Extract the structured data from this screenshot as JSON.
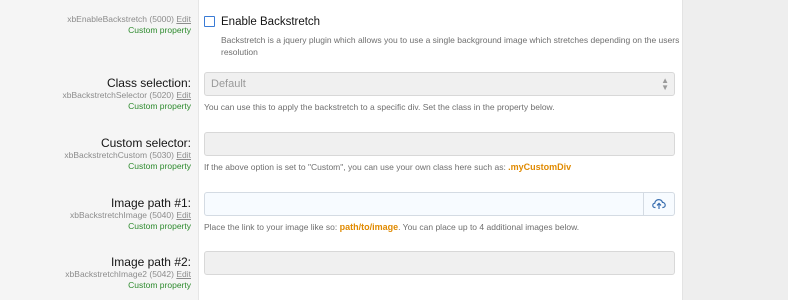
{
  "rows": [
    {
      "title": "",
      "meta": "xbEnableBackstretch (5000)",
      "edit": "Edit",
      "custom": "Custom property",
      "checkbox_label": "Enable Backstretch",
      "description": "Backstretch is a jquery plugin which allows you to use a single background image which stretches depending on the users resolution"
    },
    {
      "title": "Class selection:",
      "meta": "xbBackstretchSelector (5020)",
      "edit": "Edit",
      "custom": "Custom property",
      "select_value": "Default",
      "hint": "You can use this to apply the backstretch to a specific div. Set the class in the property below."
    },
    {
      "title": "Custom selector:",
      "meta": "xbBackstretchCustom (5030)",
      "edit": "Edit",
      "custom": "Custom property",
      "value": "",
      "hint_pre": "If the above option is set to \"Custom\", you can use your own class here such as: ",
      "hint_code": ".myCustomDiv"
    },
    {
      "title": "Image path #1:",
      "meta": "xbBackstretchImage (5040)",
      "edit": "Edit",
      "custom": "Custom property",
      "value": "",
      "upload_icon": "upload-cloud-icon",
      "hint_pre": "Place the link to your image like so: ",
      "hint_code": "path/to/image",
      "hint_post": ". You can place up to 4 additional images below."
    },
    {
      "title": "Image path #2:",
      "meta": "xbBackstretchImage2 (5042)",
      "edit": "Edit",
      "custom": "Custom property",
      "value": ""
    }
  ],
  "colors": {
    "accent": "#3a7bd5",
    "custom_property": "#2e8b2e",
    "code_highlight": "#e08a00"
  }
}
